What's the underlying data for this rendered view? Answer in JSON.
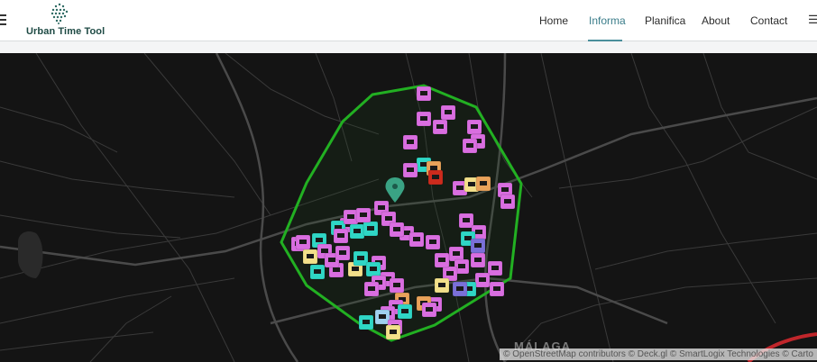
{
  "app": {
    "name": "Urban Time Tool"
  },
  "nav": {
    "items": [
      {
        "label": "Home"
      },
      {
        "label": "Informa",
        "active": true
      },
      {
        "label": "Planifica"
      },
      {
        "label": "About"
      },
      {
        "label": "Contact"
      }
    ]
  },
  "map": {
    "city_label": "MÁLAGA",
    "attribution": "© OpenStreetMap contributors © Deck.gl © SmartLogix Technologies © Carto",
    "polygon_color": "#22b022",
    "marker_colors": [
      "#d96ee0",
      "#2fd6c5",
      "#f2e08a",
      "#e8a25a",
      "#7a70d8",
      "#cc2b1d",
      "#9fd0ef"
    ]
  }
}
